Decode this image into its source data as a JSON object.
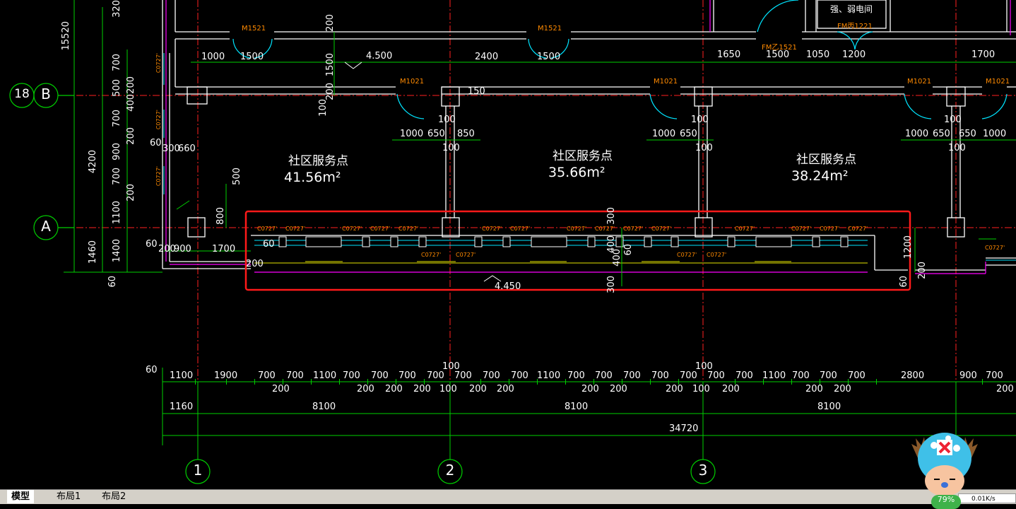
{
  "room_labels": [
    {
      "name": "社区服务点",
      "area": "41.56m²"
    },
    {
      "name": "社区服务点",
      "area": "35.66m²"
    },
    {
      "name": "社区服务点",
      "area": "38.24m²"
    }
  ],
  "axis_labels": {
    "row_18": "18",
    "row_b": "B",
    "row_a": "A",
    "col_1": "1",
    "col_2": "2",
    "col_3": "3"
  },
  "top_labels": {
    "elec_room": "强、弱电间",
    "fm_b": "FM乙1521",
    "fm_c": "FM丙1221",
    "m1521_a": "M1521",
    "m1521_b": "M1521",
    "m1021_a": "M1021",
    "m1021_b": "M1021",
    "m1021_c": "M1021",
    "m1021_d": "M1021"
  },
  "elevations": {
    "top": "4.500",
    "bottom": "4.450"
  },
  "left_dims": {
    "total": "15520",
    "d320": "320",
    "d4200": "4200",
    "d1460": "1460",
    "d60": "60",
    "stack": [
      "700",
      "500",
      "700",
      "900",
      "700",
      "1100",
      "1400"
    ],
    "stack2": [
      "200",
      "400",
      "200",
      "200"
    ]
  },
  "window_code": "C0727'",
  "dims_row1": [
    "1100",
    "1900",
    "700",
    "700",
    "1100",
    "700",
    "700",
    "700",
    "700",
    "700",
    "700",
    "700",
    "1100",
    "700",
    "700",
    "700",
    "700",
    "700",
    "700",
    "700",
    "1100",
    "700",
    "700",
    "700",
    "2800",
    "900",
    "700"
  ],
  "dims_row1b": [
    "200",
    "200",
    "200",
    "200",
    "100",
    "200",
    "200",
    "200",
    "200",
    "200",
    "100",
    "200",
    "200",
    "200",
    "200"
  ],
  "dims_row2": [
    "1160",
    "8100",
    "8100",
    "8100"
  ],
  "dims_total": "34720",
  "dims_misc": {
    "d60_left": "60",
    "d100_a": "100",
    "d100_b": "100",
    "top_row": [
      "1000",
      "1500",
      "2400",
      "1500",
      "1650",
      "1500",
      "1050",
      "1200",
      "1700"
    ],
    "mid_row_a": [
      "1000",
      "650",
      "850"
    ],
    "mid_row_b": [
      "1000",
      "650"
    ],
    "mid_row_c": [
      "1000",
      "650",
      "650",
      "1000"
    ],
    "d150": "150",
    "d300": "300",
    "d60": "60",
    "d200": "200",
    "d900": "900",
    "d1700": "1700",
    "d1200": "1200",
    "d500": "500",
    "d800": "800",
    "d1500": "1500",
    "d400": "400",
    "d100": "100",
    "d660": "660"
  },
  "tabs": [
    "模型",
    "布局1",
    "布局2"
  ],
  "net": {
    "percent": "79%",
    "speed": "0.01K/s"
  },
  "colors": {
    "background": "#000000",
    "dimension": "#00ff00",
    "wall": "#ffffff",
    "door": "#00e5ff",
    "label": "#ff8a00",
    "grid": "#ff0000",
    "highlight": "#ff0000",
    "partition": "#ff00ff"
  }
}
